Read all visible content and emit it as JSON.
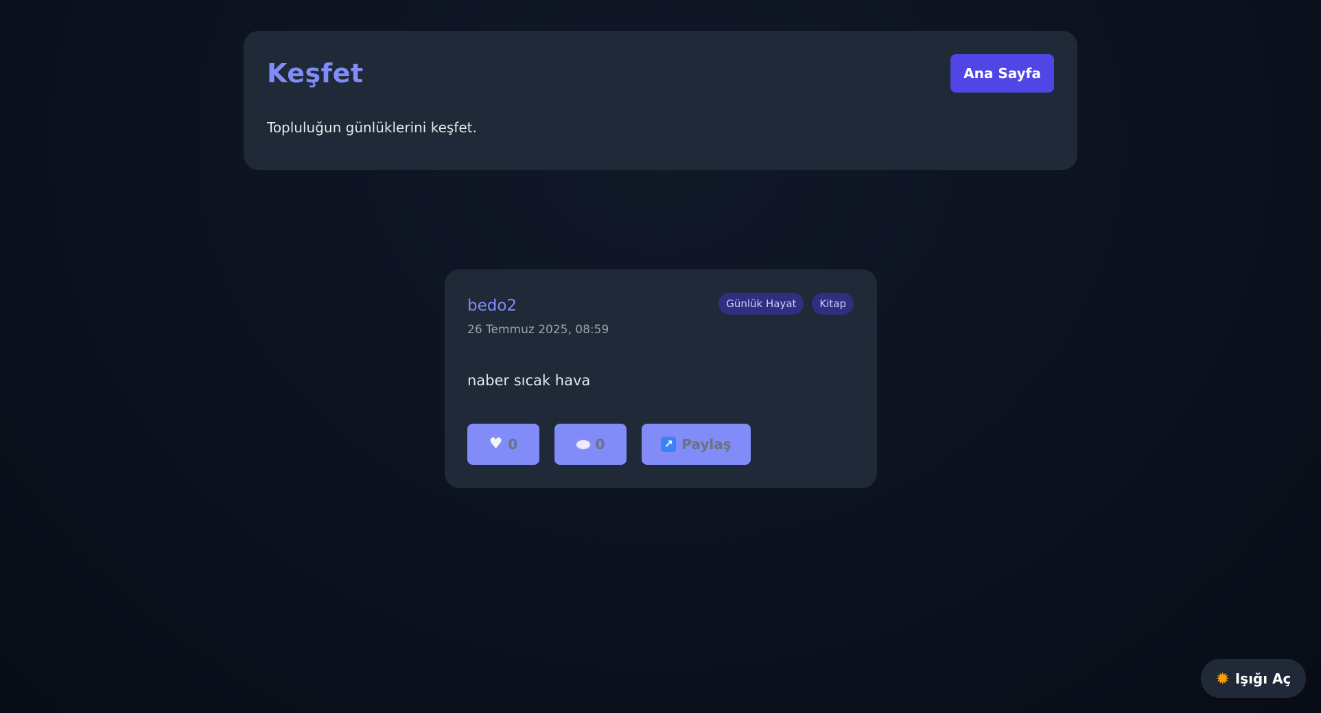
{
  "header": {
    "title": "Keşfet",
    "subtitle": "Topluluğun günlüklerini keşfet.",
    "home_button": "Ana Sayfa"
  },
  "post": {
    "author": "bedo2",
    "date": "26 Temmuz 2025, 08:59",
    "tags": [
      "Günlük Hayat",
      "Kitap"
    ],
    "content": "naber sıcak hava",
    "actions": {
      "like_icon": "heart-icon",
      "like_count": "0",
      "comment_icon": "speech-bubble-icon",
      "comment_count": "0",
      "share_icon": "share-arrow-icon",
      "share_label": "Paylaş"
    }
  },
  "theme_toggle": {
    "icon": "sun-icon",
    "label": "Işığı Aç"
  },
  "colors": {
    "accent": "#818cf8",
    "primary_button": "#4f46e5",
    "card": "#1f2937",
    "tag_bg": "#312e81"
  }
}
